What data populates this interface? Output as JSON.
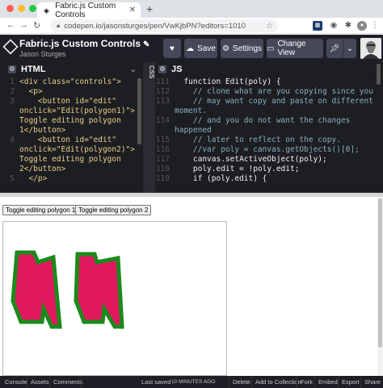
{
  "browser": {
    "tab_title": "Fabric.js Custom Controls",
    "url": "codepen.io/jasonsturges/pen/VwKjbPN?editors=1010"
  },
  "pen": {
    "title": "Fabric.js Custom Controls",
    "author": "Jason Sturges"
  },
  "header_buttons": {
    "save": "Save",
    "settings": "Settings",
    "change_view": "Change View"
  },
  "html_panel": {
    "label": "HTML",
    "lines": [
      {
        "n": "1",
        "t": "<div class=\"controls\">"
      },
      {
        "n": "2",
        "t": "  <p>"
      },
      {
        "n": "3",
        "t": "    <button id=\"edit\""
      },
      {
        "n": "",
        "t": "onclick=\"Edit(polygon1)\">"
      },
      {
        "n": "",
        "t": "Toggle editing polygon"
      },
      {
        "n": "",
        "t": "1</button>"
      },
      {
        "n": "4",
        "t": "    <button id=\"edit\""
      },
      {
        "n": "",
        "t": "onclick=\"Edit(polygon2)\">"
      },
      {
        "n": "",
        "t": "Toggle editing polygon"
      },
      {
        "n": "",
        "t": "2</button>"
      },
      {
        "n": "5",
        "t": "  </p>"
      }
    ]
  },
  "css_panel": {
    "label": "CSS"
  },
  "js_panel": {
    "label": "JS",
    "lines": [
      {
        "n": "111",
        "t": "  function Edit(poly) {"
      },
      {
        "n": "112",
        "t": "    // clone what are you copying since you"
      },
      {
        "n": "113",
        "t": "    // may want copy and paste on different"
      },
      {
        "n": "",
        "t": "moment."
      },
      {
        "n": "114",
        "t": "    // and you do not want the changes"
      },
      {
        "n": "",
        "t": "happened"
      },
      {
        "n": "115",
        "t": "    // later to reflect on the copy."
      },
      {
        "n": "116",
        "t": "    //var poly = canvas.getObjects()[0];"
      },
      {
        "n": "117",
        "t": "    canvas.setActiveObject(poly);"
      },
      {
        "n": "118",
        "t": "    poly.edit = !poly.edit;"
      },
      {
        "n": "119",
        "t": "    if (poly.edit) {"
      }
    ]
  },
  "preview": {
    "button1": "Toggle editing polygon 1",
    "button2": "Toggle editing polygon 2"
  },
  "footer": {
    "console": "Console",
    "assets": "Assets",
    "comments": "Comments",
    "last_saved": "Last saved",
    "last_saved_time": "10 MINUTES AGO",
    "delete": "Delete",
    "add_to_collection": "Add to Collection",
    "fork": "Fork",
    "embed": "Embed",
    "export": "Export",
    "share": "Share"
  },
  "colors": {
    "polygon_fill": "#e0195e",
    "polygon_stroke": "#1a8a1a",
    "editor_bg": "#1d1e22",
    "header_bg": "#1e1f26"
  }
}
